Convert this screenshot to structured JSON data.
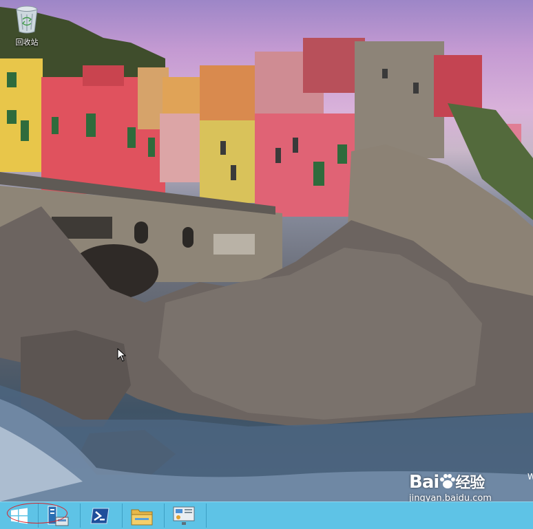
{
  "desktop": {
    "icons": [
      {
        "label": "回收站",
        "icon": "recycle-bin-icon"
      }
    ]
  },
  "taskbar": {
    "buttons": [
      {
        "name": "start",
        "icon": "windows-logo-icon"
      },
      {
        "name": "server-manager",
        "icon": "server-manager-icon"
      },
      {
        "name": "powershell",
        "icon": "powershell-icon"
      },
      {
        "name": "file-explorer",
        "icon": "folder-icon"
      },
      {
        "name": "control-panel",
        "icon": "control-panel-icon"
      }
    ],
    "color": "#5ec3e6"
  },
  "watermark": {
    "brand_left": "Bai",
    "brand_right": "经验",
    "url": "jingyan.baidu.com"
  },
  "edge_text": "W",
  "annotation": {
    "color": "#d8232a"
  }
}
